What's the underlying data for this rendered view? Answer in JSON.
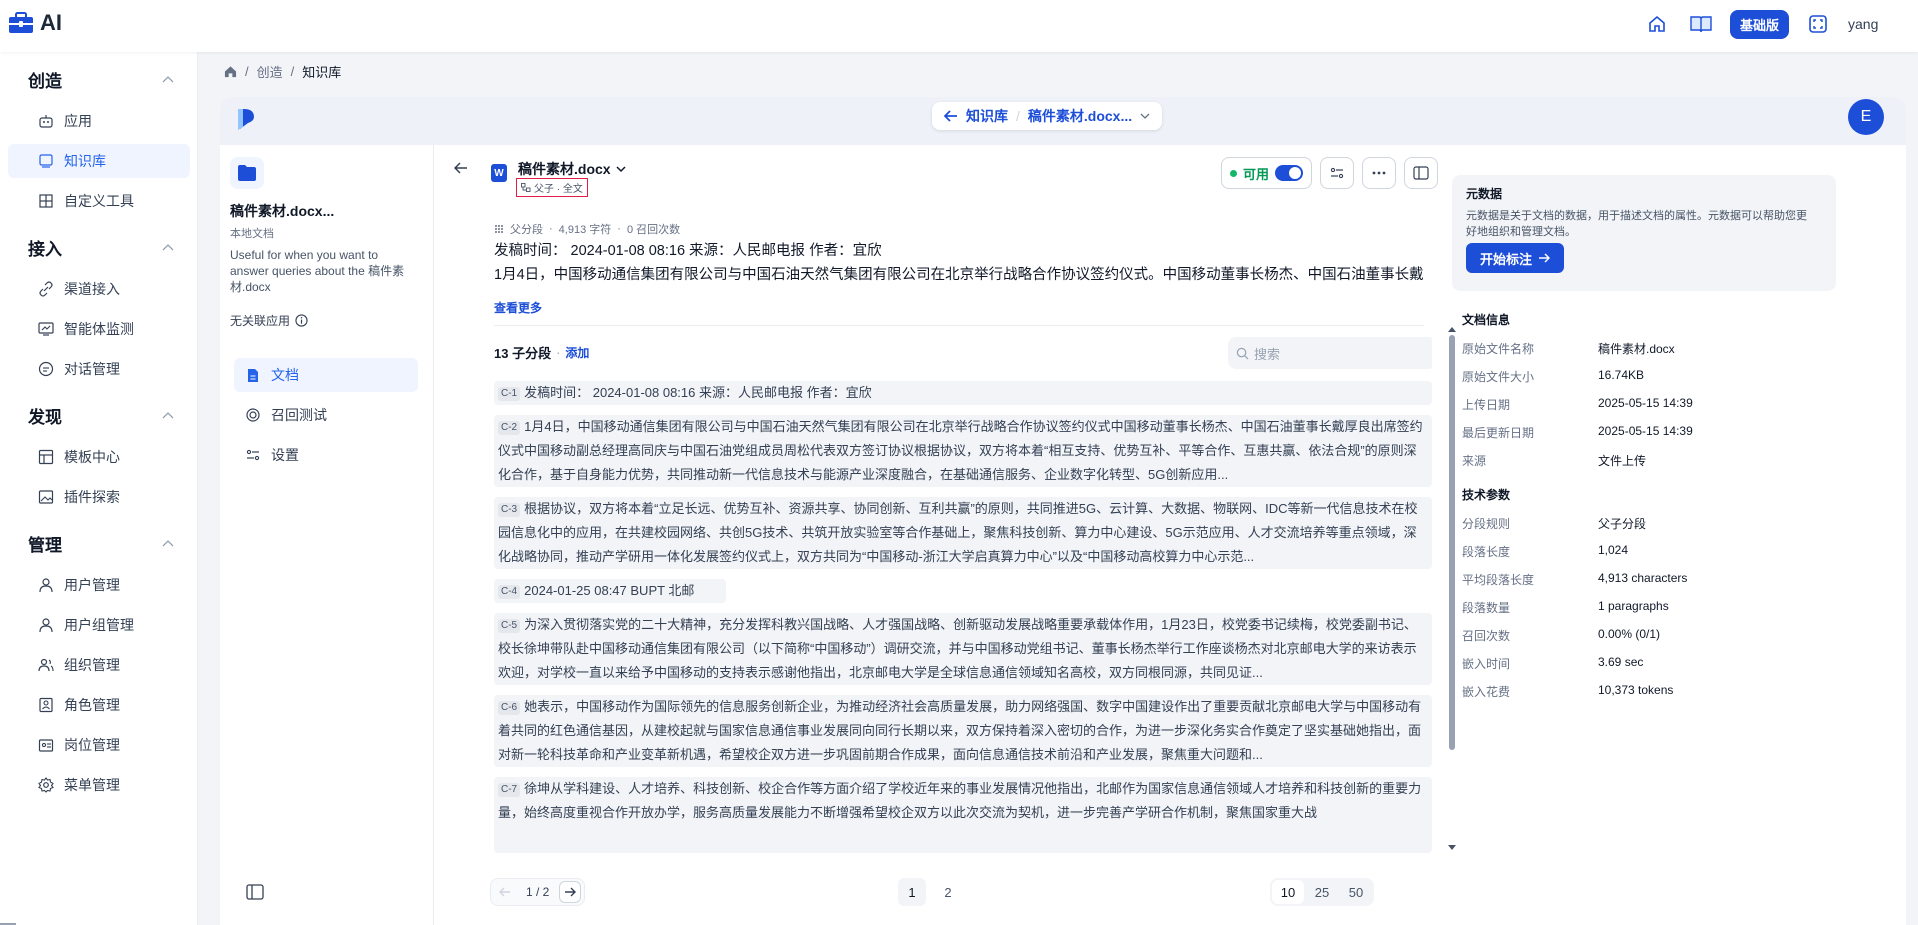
{
  "app": {
    "logo_text": "AI"
  },
  "topbar": {
    "edition_badge": "基础版",
    "username": "yang"
  },
  "sidebar": {
    "sections": [
      {
        "title": "创造",
        "items": [
          {
            "label": "应用"
          },
          {
            "label": "知识库",
            "active": true
          },
          {
            "label": "自定义工具"
          }
        ]
      },
      {
        "title": "接入",
        "items": [
          {
            "label": "渠道接入"
          },
          {
            "label": "智能体监测"
          },
          {
            "label": "对话管理"
          }
        ]
      },
      {
        "title": "发现",
        "items": [
          {
            "label": "模板中心"
          },
          {
            "label": "插件探索"
          }
        ]
      },
      {
        "title": "管理",
        "items": [
          {
            "label": "用户管理"
          },
          {
            "label": "用户组管理"
          },
          {
            "label": "组织管理"
          },
          {
            "label": "角色管理"
          },
          {
            "label": "岗位管理"
          },
          {
            "label": "菜单管理"
          }
        ]
      }
    ]
  },
  "breadcrumb": {
    "parent": "创造",
    "current": "知识库",
    "separator": "/"
  },
  "header": {
    "kb_link": "知识库",
    "file_link": "稿件素材.docx...",
    "avatar_letter": "E"
  },
  "left_panel": {
    "name": "稿件素材.docx...",
    "type": "本地文档",
    "description": "Useful for when you want to answer queries about the 稿件素材.docx",
    "app_link": "无关联应用",
    "nav": [
      {
        "label": "文档",
        "active": true
      },
      {
        "label": "召回测试"
      },
      {
        "label": "设置"
      }
    ]
  },
  "document": {
    "file_icon_letter": "W",
    "title": "稿件素材.docx",
    "mode": "父子 · 全文",
    "available_label": "可用",
    "parent_meta": {
      "type": "父分段",
      "chars": "4,913 字符",
      "recalls": "0 召回次数"
    },
    "parent_text": "发稿时间：  2024-01-08 08:16 来源：人民邮电报 作者：宜欣\n1月4日，中国移动通信集团有限公司与中国石油天然气集团有限公司在北京举行战略合作协议签约仪式。中国移动董事长杨杰、中国石油董事长戴厚良出席签约仪式。中国移动副总经理高同庆与中国石油党组成员周松代表双方签订协议。根据协议，双方将本着“相互支持、优势互补...",
    "see_more": "查看更多",
    "sub_count": "13 子分段",
    "add_label": "添加",
    "search_placeholder": "搜索",
    "chunks": [
      {
        "tag": "C-1",
        "text": "发稿时间：  2024-01-08 08:16 来源：人民邮电报 作者：宜欣"
      },
      {
        "tag": "C-2",
        "text": "1月4日，中国移动通信集团有限公司与中国石油天然气集团有限公司在北京举行战略合作协议签约仪式中国移动董事长杨杰、中国石油董事长戴厚良出席签约仪式中国移动副总经理高同庆与中国石油党组成员周松代表双方签订协议根据协议，双方将本着“相互支持、优势互补、平等合作、互惠共赢、依法合规”的原则深化合作，基于自身能力优势，共同推动新一代信息技术与能源产业深度融合，在基础通信服务、企业数字化转型、5G创新应用..."
      },
      {
        "tag": "C-3",
        "text": "根据协议，双方将本着“立足长远、优势互补、资源共享、协同创新、互利共赢”的原则，共同推进5G、云计算、大数据、物联网、IDC等新一代信息技术在校园信息化中的应用，在共建校园网络、共创5G技术、共筑开放实验室等合作基础上，聚焦科技创新、算力中心建设、5G示范应用、人才交流培养等重点领域，深化战略协同，推动产学研用一体化发展签约仪式上，双方共同为“中国移动-浙江大学启真算力中心”以及“中国移动高校算力中心示范..."
      },
      {
        "tag": "C-4",
        "text": "2024-01-25 08:47 BUPT  北邮"
      },
      {
        "tag": "C-5",
        "text": "为深入贯彻落实党的二十大精神，充分发挥科教兴国战略、人才强国战略、创新驱动发展战略重要承载体作用，1月23日，校党委书记续梅，校党委副书记、校长徐坤带队赴中国移动通信集团有限公司（以下简称“中国移动”）调研交流，并与中国移动党组书记、董事长杨杰举行工作座谈杨杰对北京邮电大学的来访表示欢迎，对学校一直以来给予中国移动的支持表示感谢他指出，北京邮电大学是全球信息通信领域知名高校，双方同根同源，共同见证..."
      },
      {
        "tag": "C-6",
        "text": "她表示，中国移动作为国际领先的信息服务创新企业，为推动经济社会高质量发展，助力网络强国、数字中国建设作出了重要贡献北京邮电大学与中国移动有着共同的红色通信基因，从建校起就与国家信息通信事业发展同向同行长期以来，双方保持着深入密切的合作，为进一步深化务实合作奠定了坚实基础她指出，面对新一轮科技革命和产业变革新机遇，希望校企双方进一步巩固前期合作成果，面向信息通信技术前沿和产业发展，聚焦重大问题和..."
      },
      {
        "tag": "C-7",
        "text": "徐坤从学科建设、人才培养、科技创新、校企合作等方面介绍了学校近年来的事业发展情况他指出，北邮作为国家信息通信领域人才培养和科技创新的重要力量，始终高度重视合作开放办学，服务高质量发展能力不断增强希望校企双方以此次交流为契机，进一步完善产学研合作机制，聚焦国家重大战"
      }
    ]
  },
  "pagination": {
    "indicator": "1 / 2",
    "pages": [
      "1",
      "2"
    ],
    "sizes": [
      "10",
      "25",
      "50"
    ],
    "current_page": "1",
    "current_size": "10"
  },
  "info": {
    "metadata_title": "元数据",
    "metadata_desc": "元数据是关于文档的数据，用于描述文档的属性。元数据可以帮助您更好地组织和管理文档。",
    "start_btn": "开始标注",
    "doc_info_title": "文档信息",
    "doc_info": [
      {
        "k": "原始文件名称",
        "v": "稿件素材.docx"
      },
      {
        "k": "原始文件大小",
        "v": "16.74KB"
      },
      {
        "k": "上传日期",
        "v": "2025-05-15 14:39"
      },
      {
        "k": "最后更新日期",
        "v": "2025-05-15 14:39"
      },
      {
        "k": "来源",
        "v": "文件上传"
      }
    ],
    "tech_title": "技术参数",
    "tech": [
      {
        "k": "分段规则",
        "v": "父子分段"
      },
      {
        "k": "段落长度",
        "v": "1,024"
      },
      {
        "k": "平均段落长度",
        "v": "4,913 characters"
      },
      {
        "k": "段落数量",
        "v": "1 paragraphs"
      },
      {
        "k": "召回次数",
        "v": "0.00% (0/1)"
      },
      {
        "k": "嵌入时间",
        "v": "3.69 sec"
      },
      {
        "k": "嵌入花费",
        "v": "10,373 tokens"
      }
    ]
  },
  "colors": {
    "accent": "#1d4ed8",
    "active_bg": "#eff4ff",
    "available": "#039855",
    "highlight_box": "#e11d48"
  }
}
